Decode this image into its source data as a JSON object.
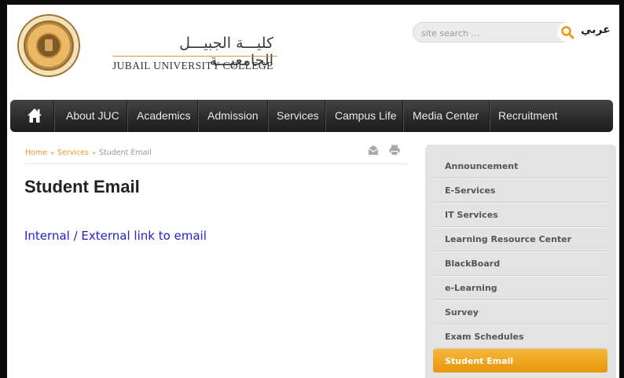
{
  "brand": {
    "name_ar": "كليـــة الجبيـــل الجامعيـــة",
    "name_en": "JUBAIL UNIVERSITY COLLEGE",
    "logo_icon": "juc-seal-logo",
    "accent_color": "#e9960d"
  },
  "search": {
    "placeholder": "site search ...",
    "icon": "search-icon"
  },
  "language_link": "عربي",
  "nav": {
    "home_icon": "home-icon",
    "items": [
      {
        "label": "About JUC"
      },
      {
        "label": "Academics"
      },
      {
        "label": "Admission"
      },
      {
        "label": "Services"
      },
      {
        "label": "Campus Life"
      },
      {
        "label": "Media Center"
      },
      {
        "label": "Recruitment"
      }
    ]
  },
  "breadcrumb": {
    "items": [
      "Home",
      "Services",
      "Student Email"
    ],
    "separator": "»"
  },
  "tools": {
    "email_icon": "email-icon",
    "print_icon": "print-icon"
  },
  "main": {
    "title": "Student Email",
    "link_text": "Internal / External link to email"
  },
  "sidebar": {
    "items": [
      {
        "label": "Announcement"
      },
      {
        "label": "E-Services"
      },
      {
        "label": "IT Services"
      },
      {
        "label": "Learning Resource Center"
      },
      {
        "label": "BlackBoard"
      },
      {
        "label": "e-Learning"
      },
      {
        "label": "Survey"
      },
      {
        "label": "Exam Schedules"
      },
      {
        "label": "Student Email",
        "active": true
      }
    ]
  }
}
